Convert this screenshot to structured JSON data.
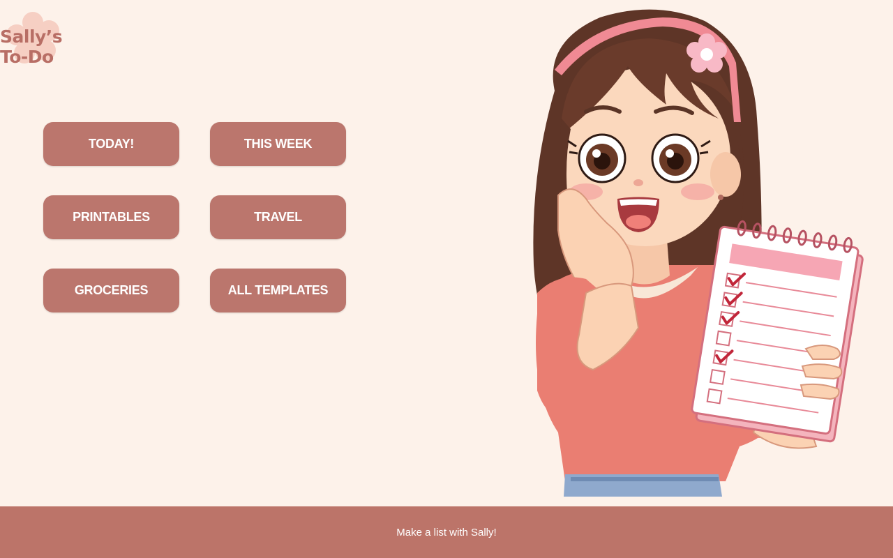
{
  "logo": {
    "line1": "Sally’s",
    "line2": "To-Do"
  },
  "nav": {
    "buttons": [
      {
        "label": "TODAY!"
      },
      {
        "label": "THIS WEEK"
      },
      {
        "label": "PRINTABLES"
      },
      {
        "label": "TRAVEL"
      },
      {
        "label": "GROCERIES"
      },
      {
        "label": "ALL TEMPLATES"
      }
    ]
  },
  "footer": {
    "text": "Make a list with Sally!"
  },
  "illustration": {
    "subject": "girl-holding-checklist",
    "checklist_checked": 4,
    "checklist_total": 7
  },
  "colors": {
    "background": "#fdf2ea",
    "button": "#bb766d",
    "footer": "#bc7469",
    "logo": "#b86e65"
  }
}
